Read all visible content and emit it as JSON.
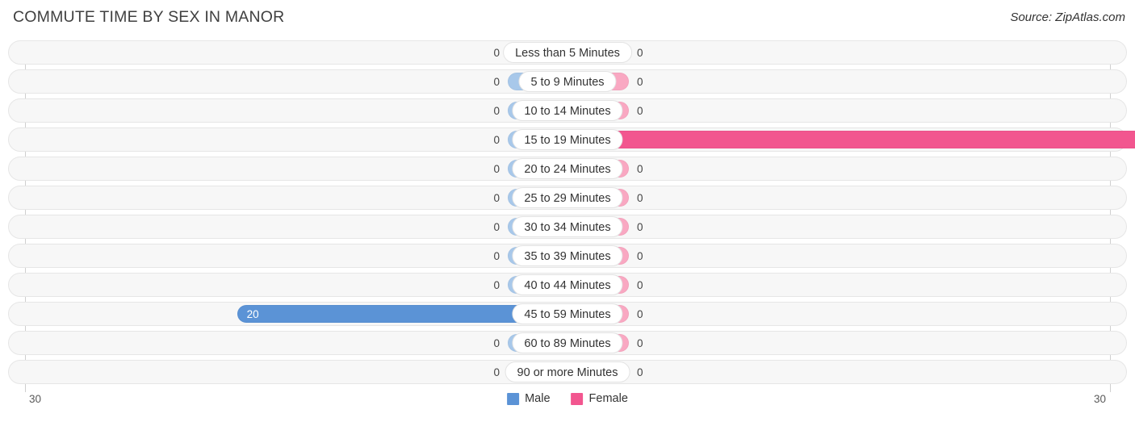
{
  "header": {
    "title": "COMMUTE TIME BY SEX IN MANOR",
    "source": "Source: ZipAtlas.com"
  },
  "legend": {
    "items": [
      {
        "label": "Male",
        "color": "#5b93d6"
      },
      {
        "label": "Female",
        "color": "#f2568f"
      }
    ]
  },
  "axis": {
    "left_tick": "30",
    "right_tick": "30",
    "max": 30
  },
  "chart_data": {
    "type": "bar",
    "subtype": "diverging-bidirectional",
    "title": "COMMUTE TIME BY SEX IN MANOR",
    "xlabel": "",
    "ylabel": "",
    "xlim": [
      30,
      30
    ],
    "grid": false,
    "legend_position": "bottom-center",
    "categories": [
      "Less than 5 Minutes",
      "5 to 9 Minutes",
      "10 to 14 Minutes",
      "15 to 19 Minutes",
      "20 to 24 Minutes",
      "25 to 29 Minutes",
      "30 to 34 Minutes",
      "35 to 39 Minutes",
      "40 to 44 Minutes",
      "45 to 59 Minutes",
      "60 to 89 Minutes",
      "90 or more Minutes"
    ],
    "series": [
      {
        "name": "Male",
        "color": "#5b93d6",
        "values": [
          0,
          0,
          0,
          0,
          0,
          0,
          0,
          0,
          0,
          20,
          0,
          0
        ]
      },
      {
        "name": "Female",
        "color": "#f2568f",
        "values": [
          0,
          0,
          0,
          29,
          0,
          0,
          0,
          0,
          0,
          0,
          0,
          0
        ]
      }
    ]
  },
  "rows": [
    {
      "label": "Less than 5 Minutes",
      "male": "0",
      "female": "0"
    },
    {
      "label": "5 to 9 Minutes",
      "male": "0",
      "female": "0"
    },
    {
      "label": "10 to 14 Minutes",
      "male": "0",
      "female": "0"
    },
    {
      "label": "15 to 19 Minutes",
      "male": "0",
      "female": "29"
    },
    {
      "label": "20 to 24 Minutes",
      "male": "0",
      "female": "0"
    },
    {
      "label": "25 to 29 Minutes",
      "male": "0",
      "female": "0"
    },
    {
      "label": "30 to 34 Minutes",
      "male": "0",
      "female": "0"
    },
    {
      "label": "35 to 39 Minutes",
      "male": "0",
      "female": "0"
    },
    {
      "label": "40 to 44 Minutes",
      "male": "0",
      "female": "0"
    },
    {
      "label": "45 to 59 Minutes",
      "male": "20",
      "female": "0"
    },
    {
      "label": "60 to 89 Minutes",
      "male": "0",
      "female": "0"
    },
    {
      "label": "90 or more Minutes",
      "male": "0",
      "female": "0"
    }
  ]
}
